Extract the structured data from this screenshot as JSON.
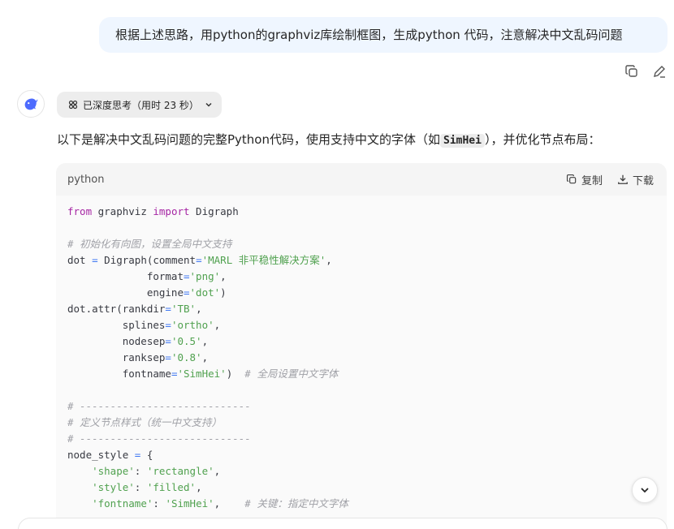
{
  "user_message": "根据上述思路，用python的graphviz库绘制框图，生成python 代码，注意解决中文乱码问题",
  "message_actions": {
    "copy_icon": "copy-icon",
    "edit_icon": "edit-icon"
  },
  "assistant": {
    "avatar_icon": "deepseek-whale-icon",
    "thinking_label": "已深度思考（用时 23 秒）",
    "intro_before": "以下是解决中文乱码问题的完整Python代码，使用支持中文的字体（如",
    "intro_code": "SimHei",
    "intro_after": "），并优化节点布局："
  },
  "code_block": {
    "language": "python",
    "copy_label": "复制",
    "download_label": "下载",
    "lines": [
      [
        {
          "t": "kw",
          "v": "from"
        },
        {
          "t": "",
          "v": " graphviz "
        },
        {
          "t": "kw",
          "v": "import"
        },
        {
          "t": "",
          "v": " Digraph"
        }
      ],
      [],
      [
        {
          "t": "cm",
          "v": "# 初始化有向图，设置全局中文支持"
        }
      ],
      [
        {
          "t": "",
          "v": "dot "
        },
        {
          "t": "op",
          "v": "="
        },
        {
          "t": "",
          "v": " Digraph(comment"
        },
        {
          "t": "op",
          "v": "="
        },
        {
          "t": "str",
          "v": "'MARL 非平稳性解决方案'"
        },
        {
          "t": "",
          "v": ","
        }
      ],
      [
        {
          "t": "",
          "v": "             format"
        },
        {
          "t": "op",
          "v": "="
        },
        {
          "t": "str",
          "v": "'png'"
        },
        {
          "t": "",
          "v": ","
        }
      ],
      [
        {
          "t": "",
          "v": "             engine"
        },
        {
          "t": "op",
          "v": "="
        },
        {
          "t": "str",
          "v": "'dot'"
        },
        {
          "t": "",
          "v": ")"
        }
      ],
      [
        {
          "t": "",
          "v": "dot.attr(rankdir"
        },
        {
          "t": "op",
          "v": "="
        },
        {
          "t": "str",
          "v": "'TB'"
        },
        {
          "t": "",
          "v": ","
        }
      ],
      [
        {
          "t": "",
          "v": "         splines"
        },
        {
          "t": "op",
          "v": "="
        },
        {
          "t": "str",
          "v": "'ortho'"
        },
        {
          "t": "",
          "v": ","
        }
      ],
      [
        {
          "t": "",
          "v": "         nodesep"
        },
        {
          "t": "op",
          "v": "="
        },
        {
          "t": "str",
          "v": "'0.5'"
        },
        {
          "t": "",
          "v": ","
        }
      ],
      [
        {
          "t": "",
          "v": "         ranksep"
        },
        {
          "t": "op",
          "v": "="
        },
        {
          "t": "str",
          "v": "'0.8'"
        },
        {
          "t": "",
          "v": ","
        }
      ],
      [
        {
          "t": "",
          "v": "         fontname"
        },
        {
          "t": "op",
          "v": "="
        },
        {
          "t": "str",
          "v": "'SimHei'"
        },
        {
          "t": "",
          "v": ")  "
        },
        {
          "t": "cm",
          "v": "# 全局设置中文字体"
        }
      ],
      [],
      [
        {
          "t": "cm",
          "v": "# ----------------------------"
        }
      ],
      [
        {
          "t": "cm",
          "v": "# 定义节点样式（统一中文支持）"
        }
      ],
      [
        {
          "t": "cm",
          "v": "# ----------------------------"
        }
      ],
      [
        {
          "t": "",
          "v": "node_style "
        },
        {
          "t": "op",
          "v": "="
        },
        {
          "t": "",
          "v": " {"
        }
      ],
      [
        {
          "t": "",
          "v": "    "
        },
        {
          "t": "str",
          "v": "'shape'"
        },
        {
          "t": "",
          "v": ": "
        },
        {
          "t": "str",
          "v": "'rectangle'"
        },
        {
          "t": "",
          "v": ","
        }
      ],
      [
        {
          "t": "",
          "v": "    "
        },
        {
          "t": "str",
          "v": "'style'"
        },
        {
          "t": "",
          "v": ": "
        },
        {
          "t": "str",
          "v": "'filled'"
        },
        {
          "t": "",
          "v": ","
        }
      ],
      [
        {
          "t": "",
          "v": "    "
        },
        {
          "t": "str",
          "v": "'fontname'"
        },
        {
          "t": "",
          "v": ": "
        },
        {
          "t": "str",
          "v": "'SimHei'"
        },
        {
          "t": "",
          "v": ",    "
        },
        {
          "t": "cm",
          "v": "# 关键：指定中文字体"
        }
      ]
    ]
  },
  "scroll_down_icon": "chevron-down-icon"
}
